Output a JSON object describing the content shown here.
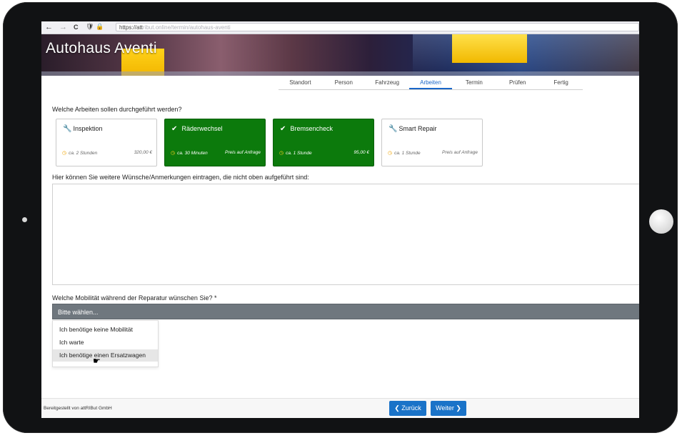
{
  "browser": {
    "back": "←",
    "forward": "→",
    "reload": "C",
    "url_visible": "https://att",
    "url_blurred": "ribut.online/termin/autohaus-aventi"
  },
  "header": {
    "brand": "Autohaus Aventi"
  },
  "steps": [
    "Standort",
    "Person",
    "Fahrzeug",
    "Arbeiten",
    "Termin",
    "Prüfen",
    "Fertig"
  ],
  "active_step": "Arbeiten",
  "work_question": "Welche Arbeiten sollen durchgeführt werden?",
  "services": [
    {
      "name": "Inspektion",
      "icon": "wrench-icon",
      "duration": "ca. 2 Stunden",
      "price": "320,00 €",
      "selected": false
    },
    {
      "name": "Räderwechsel",
      "icon": "check-icon",
      "duration": "ca. 30 Minuten",
      "price": "Preis auf Anfrage",
      "selected": true
    },
    {
      "name": "Bremsencheck",
      "icon": "check-icon",
      "duration": "ca. 1 Stunde",
      "price": "95,00 €",
      "selected": true
    },
    {
      "name": "Smart Repair",
      "icon": "wrench-icon",
      "duration": "ca. 1 Stunde",
      "price": "Preis auf Anfrage",
      "selected": false
    }
  ],
  "notes_label": "Hier können Sie weitere Wünsche/Anmerkungen eintragen, die nicht oben aufgeführt sind:",
  "notes_value": "",
  "mobility": {
    "label": "Welche Mobilität während der Reparatur wünschen Sie?  *",
    "placeholder": "Bitte wählen...",
    "options": [
      "Ich benötige keine Mobilität",
      "Ich warte",
      "Ich benötige einen Ersatzwagen"
    ],
    "hovered_option": "Ich benötige einen Ersatzwagen"
  },
  "footer": {
    "provided_by": "Bereitgestellt von attRIBut GmbH",
    "back_label": "Zurück",
    "next_label": "Weiter"
  },
  "colors": {
    "selected_card": "#0c7a0c",
    "primary_button": "#1a73c8",
    "accent": "#f0a400"
  }
}
